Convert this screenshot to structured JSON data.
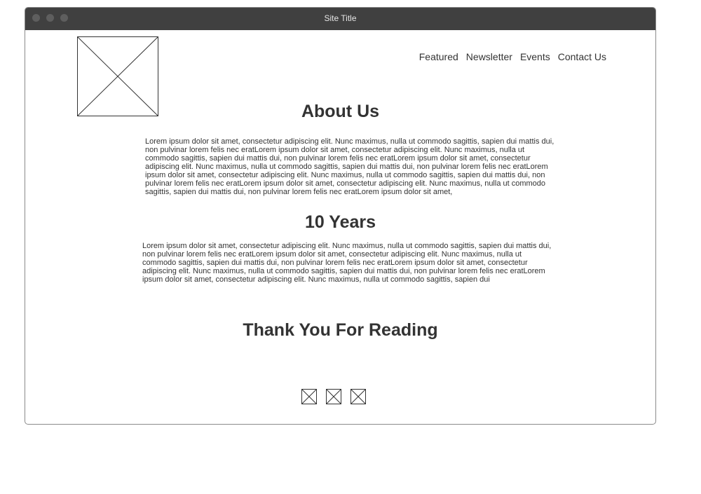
{
  "window": {
    "title": "Site Title"
  },
  "nav": {
    "items": [
      "Featured",
      "Newsletter",
      "Events",
      "Contact Us"
    ]
  },
  "about": {
    "heading": "About Us",
    "body": "Lorem ipsum dolor sit amet, consectetur adipiscing elit. Nunc maximus, nulla ut commodo sagittis, sapien dui mattis dui, non pulvinar lorem felis nec eratLorem ipsum dolor sit amet, consectetur adipiscing elit. Nunc maximus, nulla ut commodo sagittis, sapien dui mattis dui, non pulvinar lorem felis nec eratLorem ipsum dolor sit amet, consectetur adipiscing elit. Nunc maximus, nulla ut commodo sagittis, sapien dui mattis dui, non pulvinar lorem felis nec eratLorem ipsum dolor sit amet, consectetur adipiscing elit. Nunc maximus, nulla ut commodo sagittis, sapien dui mattis dui, non pulvinar lorem felis nec eratLorem ipsum dolor sit amet, consectetur adipiscing elit. Nunc maximus, nulla ut commodo sagittis, sapien dui mattis dui, non pulvinar lorem felis nec eratLorem ipsum dolor sit amet,"
  },
  "years": {
    "heading": "10 Years",
    "body": "Lorem ipsum dolor sit amet, consectetur adipiscing elit. Nunc maximus, nulla ut commodo sagittis, sapien dui mattis dui, non pulvinar lorem felis nec eratLorem ipsum dolor sit amet, consectetur adipiscing elit. Nunc maximus, nulla ut commodo sagittis, sapien dui mattis dui, non pulvinar lorem felis nec eratLorem ipsum dolor sit amet, consectetur adipiscing elit. Nunc maximus, nulla ut commodo sagittis, sapien dui mattis dui, non pulvinar lorem felis nec eratLorem ipsum dolor sit amet, consectetur adipiscing elit. Nunc maximus, nulla ut commodo sagittis, sapien dui"
  },
  "closing": {
    "heading": "Thank You For Reading"
  },
  "icons": {
    "logo": "image-placeholder-icon",
    "socials": [
      "image-placeholder-icon",
      "image-placeholder-icon",
      "image-placeholder-icon"
    ]
  },
  "colors": {
    "titlebar": "#404040",
    "text": "#333333",
    "border": "#8a8a8a"
  }
}
